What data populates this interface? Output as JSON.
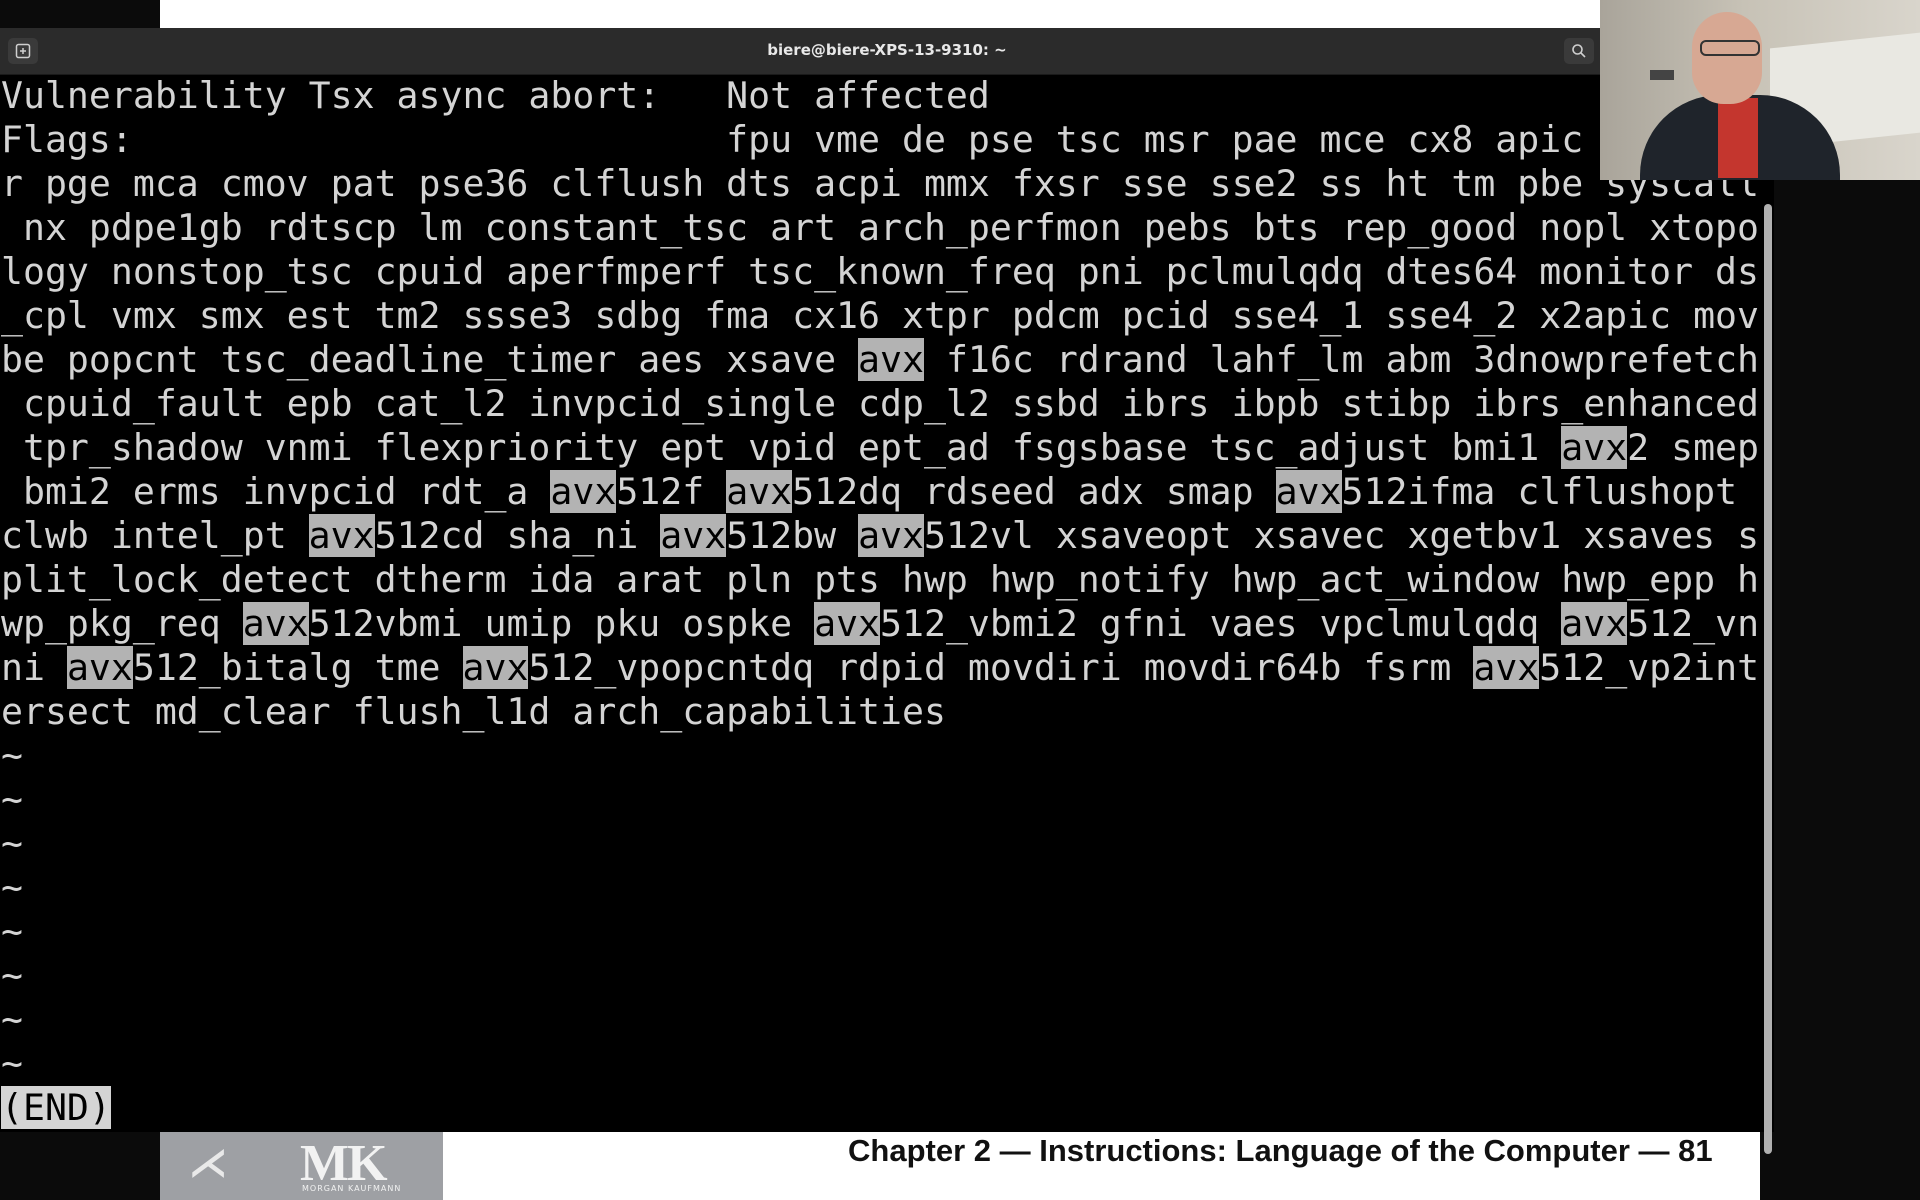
{
  "window": {
    "title": "biere@biere-XPS-13-9310: ~"
  },
  "terminal": {
    "lines": [
      [
        {
          "t": "Vulnerability Tsx async abort:   Not affected"
        }
      ],
      [
        {
          "t": "Flags:                           fpu vme de pse tsc msr pae mce cx8 apic"
        }
      ],
      [
        {
          "t": "r pge mca cmov pat pse36 clflush dts acpi mmx fxsr sse sse2 ss ht tm pbe syscall"
        }
      ],
      [
        {
          "t": " nx pdpe1gb rdtscp lm constant_tsc art arch_perfmon pebs bts rep_good nopl xtopo"
        }
      ],
      [
        {
          "t": "logy nonstop_tsc cpuid aperfmperf tsc_known_freq pni pclmulqdq dtes64 monitor ds"
        }
      ],
      [
        {
          "t": "_cpl vmx smx est tm2 ssse3 sdbg fma cx16 xtpr pdcm pcid sse4_1 sse4_2 x2apic mov"
        }
      ],
      [
        {
          "t": "be popcnt tsc_deadline_timer aes xsave "
        },
        {
          "t": "avx",
          "h": true
        },
        {
          "t": " f16c rdrand lahf_lm abm 3dnowprefetch"
        }
      ],
      [
        {
          "t": " cpuid_fault epb cat_l2 invpcid_single cdp_l2 ssbd ibrs ibpb stibp ibrs_enhanced"
        }
      ],
      [
        {
          "t": " tpr_shadow vnmi flexpriority ept vpid ept_ad fsgsbase tsc_adjust bmi1 "
        },
        {
          "t": "avx",
          "h": true
        },
        {
          "t": "2 smep"
        }
      ],
      [
        {
          "t": " bmi2 erms invpcid rdt_a "
        },
        {
          "t": "avx",
          "h": true
        },
        {
          "t": "512f "
        },
        {
          "t": "avx",
          "h": true
        },
        {
          "t": "512dq rdseed adx smap "
        },
        {
          "t": "avx",
          "h": true
        },
        {
          "t": "512ifma clflushopt"
        }
      ],
      [
        {
          "t": "clwb intel_pt "
        },
        {
          "t": "avx",
          "h": true
        },
        {
          "t": "512cd sha_ni "
        },
        {
          "t": "avx",
          "h": true
        },
        {
          "t": "512bw "
        },
        {
          "t": "avx",
          "h": true
        },
        {
          "t": "512vl xsaveopt xsavec xgetbv1 xsaves s"
        }
      ],
      [
        {
          "t": "plit_lock_detect dtherm ida arat pln pts hwp hwp_notify hwp_act_window hwp_epp h"
        }
      ],
      [
        {
          "t": "wp_pkg_req "
        },
        {
          "t": "avx",
          "h": true
        },
        {
          "t": "512vbmi umip pku ospke "
        },
        {
          "t": "avx",
          "h": true
        },
        {
          "t": "512_vbmi2 gfni vaes vpclmulqdq "
        },
        {
          "t": "avx",
          "h": true
        },
        {
          "t": "512_vn"
        }
      ],
      [
        {
          "t": "ni "
        },
        {
          "t": "avx",
          "h": true
        },
        {
          "t": "512_bitalg tme "
        },
        {
          "t": "avx",
          "h": true
        },
        {
          "t": "512_vpopcntdq rdpid movdiri movdir64b fsrm "
        },
        {
          "t": "avx",
          "h": true
        },
        {
          "t": "512_vp2int"
        }
      ],
      [
        {
          "t": "ersect md_clear flush_l1d arch_capabilities"
        }
      ]
    ],
    "tilde": "~",
    "tilde_count": 8,
    "end_marker": "(END)"
  },
  "slide": {
    "footer": "Chapter 2 — Instructions: Language of the Computer — 81",
    "logo_text": "MK",
    "logo_subtext": "MORGAN KAUFMANN"
  },
  "icons": {
    "newtab": "new-tab-icon",
    "search": "search-icon"
  }
}
